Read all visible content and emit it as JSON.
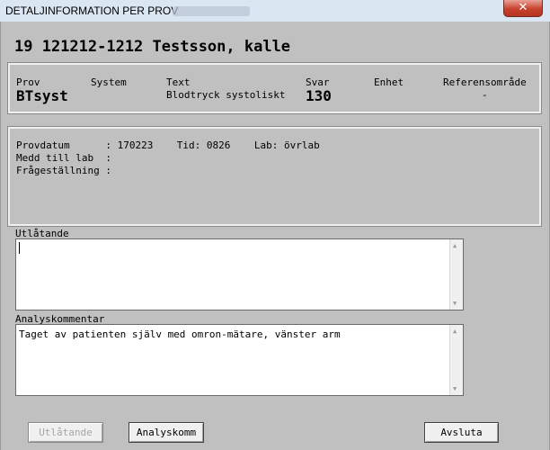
{
  "window": {
    "title": "DETALJINFORMATION PER PROV",
    "close_glyph": "✕"
  },
  "patient": {
    "header": "19 121212-1212 Testsson, kalle"
  },
  "test": {
    "prov_label": "Prov",
    "prov_value": "BTsyst",
    "system_label": "System",
    "text_label": "Text",
    "text_value": "Blodtryck systoliskt",
    "svar_label": "Svar",
    "svar_value": "130",
    "enhet_label": "Enhet",
    "ref_label": "Referensområde",
    "ref_value": "-"
  },
  "details": {
    "provdatum_line": "Provdatum      : 170223    Tid: 0826    Lab: övrlab",
    "medd_line": "Medd till lab  :",
    "fragestallning_line": "Frågeställning :"
  },
  "utlatande": {
    "label": "Utlåtande",
    "value": ""
  },
  "analyskommentar": {
    "label": "Analyskommentar",
    "value": "Taget av patienten själv med omron-mätare, vänster arm"
  },
  "buttons": {
    "utlatande": "Utlåtande",
    "analyskomm": "Analyskomm",
    "avsluta": "Avsluta"
  },
  "scroll": {
    "up": "▲",
    "down": "▼"
  }
}
